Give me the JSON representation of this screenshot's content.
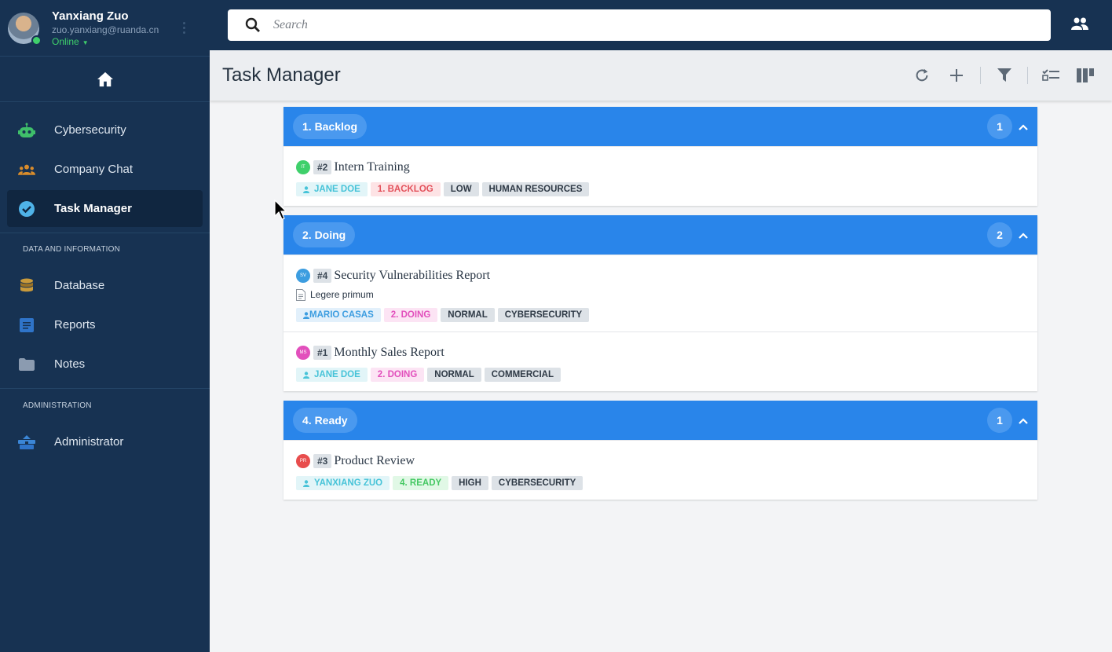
{
  "user": {
    "name": "Yanxiang Zuo",
    "email": "zuo.yanxiang@ruanda.cn",
    "status": "Online"
  },
  "sidebar": {
    "items": [
      {
        "label": "Cybersecurity",
        "icon": "robot-icon",
        "color": "#3fbf6a"
      },
      {
        "label": "Company Chat",
        "icon": "group-icon",
        "color": "#d98c2b"
      },
      {
        "label": "Task Manager",
        "icon": "check-circle-icon",
        "color": "#4fb3e8",
        "active": true
      }
    ],
    "section1": "DATA AND INFORMATION",
    "items2": [
      {
        "label": "Database",
        "icon": "database-icon",
        "color": "#c99a3b"
      },
      {
        "label": "Reports",
        "icon": "report-icon",
        "color": "#2f74c9"
      },
      {
        "label": "Notes",
        "icon": "folder-icon",
        "color": "#8b9bb0"
      }
    ],
    "section2": "ADMINISTRATION",
    "items3": [
      {
        "label": "Administrator",
        "icon": "admin-icon",
        "color": "#3b86d6"
      }
    ]
  },
  "search": {
    "placeholder": "Search"
  },
  "header": {
    "title": "Task Manager"
  },
  "groups": [
    {
      "label": "1. Backlog",
      "count": "1",
      "tasks": [
        {
          "avatar": "IT",
          "avatar_color": "#3fd06b",
          "id": "#2",
          "title": "Intern Training",
          "tags": [
            {
              "text": "JANE DOE",
              "kind": "assignee"
            },
            {
              "text": "1. BACKLOG",
              "kind": "backlog"
            },
            {
              "text": "LOW",
              "kind": "plain"
            },
            {
              "text": "HUMAN RESOURCES",
              "kind": "plain"
            }
          ]
        }
      ]
    },
    {
      "label": "2. Doing",
      "count": "2",
      "tasks": [
        {
          "avatar": "SV",
          "avatar_color": "#3c9de0",
          "id": "#4",
          "title": "Security Vulnerabilities Report",
          "desc": "Legere primum",
          "tags": [
            {
              "text": "MARIO CASAS",
              "kind": "blue-user"
            },
            {
              "text": "2. DOING",
              "kind": "doing"
            },
            {
              "text": "NORMAL",
              "kind": "plain"
            },
            {
              "text": "CYBERSECURITY",
              "kind": "plain"
            }
          ]
        },
        {
          "avatar": "MS",
          "avatar_color": "#e24fbc",
          "id": "#1",
          "title": "Monthly Sales Report",
          "tags": [
            {
              "text": "JANE DOE",
              "kind": "assignee"
            },
            {
              "text": "2. DOING",
              "kind": "doing"
            },
            {
              "text": "NORMAL",
              "kind": "plain"
            },
            {
              "text": "COMMERCIAL",
              "kind": "plain"
            }
          ]
        }
      ]
    },
    {
      "label": "4. Ready",
      "count": "1",
      "tasks": [
        {
          "avatar": "PR",
          "avatar_color": "#e84d4d",
          "id": "#3",
          "title": "Product Review",
          "tags": [
            {
              "text": "YANXIANG ZUO",
              "kind": "assignee"
            },
            {
              "text": "4. READY",
              "kind": "ready"
            },
            {
              "text": "HIGH",
              "kind": "plain"
            },
            {
              "text": "CYBERSECURITY",
              "kind": "plain"
            }
          ]
        }
      ]
    }
  ]
}
